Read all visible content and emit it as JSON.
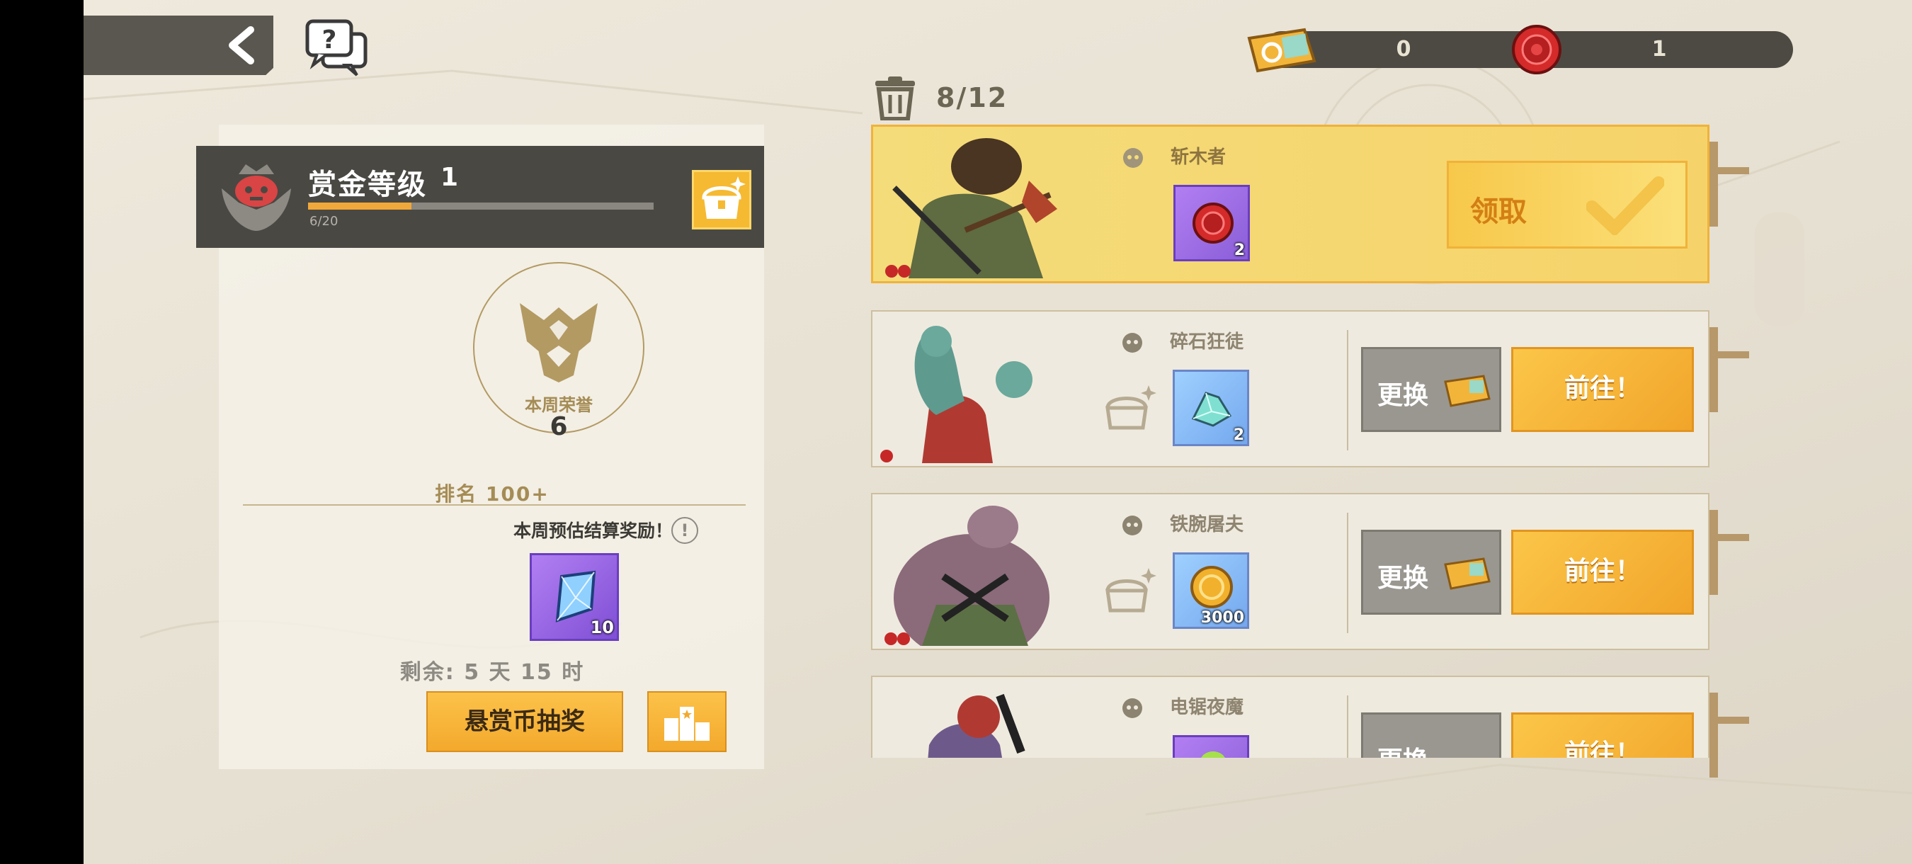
{
  "currency": {
    "tickets": "0",
    "coins": "1"
  },
  "bin": {
    "count": "8/12"
  },
  "bounty": {
    "title": "赏金等级",
    "level": "1",
    "xp_text": "6/20",
    "xp_fraction": 0.3,
    "honor_label": "本周荣誉",
    "honor_value": "6",
    "rank": "排名 100+",
    "weekly_reward_text": "本周预估结算奖励！",
    "reward_qty": "10",
    "remaining": "剩余: 5 天 15 时",
    "lottery_label": "悬赏币抽奖"
  },
  "bounties": [
    {
      "name": "斩木者",
      "reward_qty": "2",
      "reward_kind": "red-coin",
      "action": "领取",
      "claimable": true
    },
    {
      "name": "碎石狂徒",
      "reward_qty": "2",
      "reward_kind": "crystal",
      "swap": "更换",
      "go": "前往！",
      "claimable": false
    },
    {
      "name": "铁腕屠夫",
      "reward_qty": "3000",
      "reward_kind": "gold-coin",
      "swap": "更换",
      "go": "前往！",
      "claimable": false
    },
    {
      "name": "电锯夜魔",
      "reward_qty": "",
      "reward_kind": "potion",
      "swap": "更换",
      "go": "前往！",
      "claimable": false
    }
  ],
  "colors": {
    "accent": "#f3a92c",
    "panel_dark": "#4a4843",
    "active_card": "#f4dc7a"
  }
}
